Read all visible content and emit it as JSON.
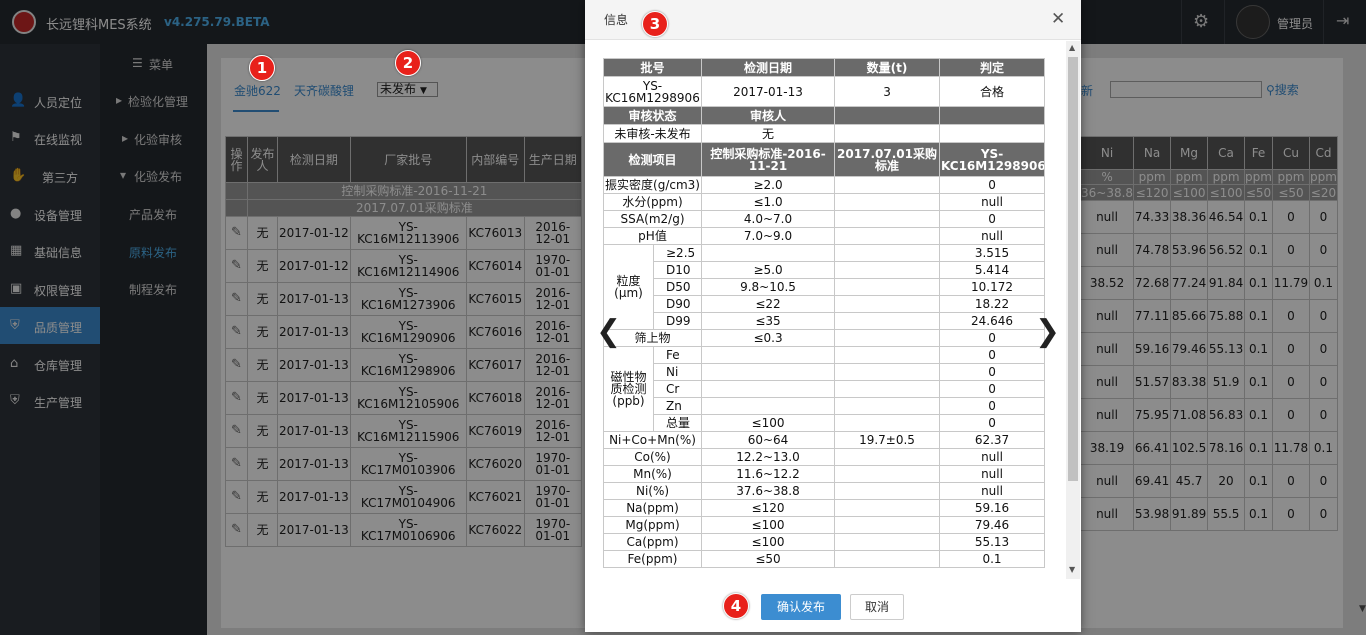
{
  "app": {
    "title": "长远锂科MES系统",
    "version": "v4.275.79.BETA",
    "user": "管理员"
  },
  "sidebar": {
    "items": [
      {
        "label": "人员定位",
        "icon": "user-location-icon"
      },
      {
        "label": "在线监视",
        "icon": "monitor-icon"
      },
      {
        "label": "第三方",
        "icon": "handshake-icon"
      },
      {
        "label": "设备管理",
        "icon": "device-icon"
      },
      {
        "label": "基础信息",
        "icon": "info-icon"
      },
      {
        "label": "权限管理",
        "icon": "lock-icon"
      },
      {
        "label": "品质管理",
        "icon": "shield-icon",
        "active": true
      },
      {
        "label": "仓库管理",
        "icon": "warehouse-icon"
      },
      {
        "label": "生产管理",
        "icon": "production-icon"
      }
    ]
  },
  "submenu": {
    "header": "菜单",
    "items": [
      "检验化管理",
      "化验审核",
      "化验发布",
      "产品发布",
      "原料发布",
      "制程发布"
    ]
  },
  "toolbar": {
    "tab1": "金驰622",
    "tab2": "天齐碳酸锂",
    "status": "未发布",
    "new_label": "新",
    "search_label": "搜索"
  },
  "grid": {
    "headers": [
      "操作",
      "发布人",
      "检测日期",
      "厂家批号",
      "内部编号",
      "生产日期"
    ],
    "band1": "控制采购标准-2016-11-21",
    "band2": "2017.07.01采购标准",
    "rows": [
      {
        "pub": "无",
        "date": "2017-01-12",
        "batch": "YS-KC16M12113906",
        "code": "KC76013",
        "prod": "2016-12-01"
      },
      {
        "pub": "无",
        "date": "2017-01-12",
        "batch": "YS-KC16M12114906",
        "code": "KC76014",
        "prod": "1970-01-01"
      },
      {
        "pub": "无",
        "date": "2017-01-13",
        "batch": "YS-KC16M1273906",
        "code": "KC76015",
        "prod": "2016-12-01"
      },
      {
        "pub": "无",
        "date": "2017-01-13",
        "batch": "YS-KC16M1290906",
        "code": "KC76016",
        "prod": "2016-12-01"
      },
      {
        "pub": "无",
        "date": "2017-01-13",
        "batch": "YS-KC16M1298906",
        "code": "KC76017",
        "prod": "2016-12-01"
      },
      {
        "pub": "无",
        "date": "2017-01-13",
        "batch": "YS-KC16M12105906",
        "code": "KC76018",
        "prod": "2016-12-01"
      },
      {
        "pub": "无",
        "date": "2017-01-13",
        "batch": "YS-KC16M12115906",
        "code": "KC76019",
        "prod": "2016-12-01"
      },
      {
        "pub": "无",
        "date": "2017-01-13",
        "batch": "YS-KC17M0103906",
        "code": "KC76020",
        "prod": "1970-01-01"
      },
      {
        "pub": "无",
        "date": "2017-01-13",
        "batch": "YS-KC17M0104906",
        "code": "KC76021",
        "prod": "1970-01-01"
      },
      {
        "pub": "无",
        "date": "2017-01-13",
        "batch": "YS-KC17M0106906",
        "code": "KC76022",
        "prod": "1970-01-01"
      }
    ]
  },
  "grid_right": {
    "headers": [
      "Ni",
      "Na",
      "Mg",
      "Ca",
      "Fe",
      "Cu",
      "Cd"
    ],
    "units": [
      "%",
      "ppm",
      "ppm",
      "ppm",
      "ppm",
      "ppm",
      "ppm"
    ],
    "limits": [
      "36~38.8",
      "≤120",
      "≤100",
      "≤100",
      "≤50",
      "≤50",
      "≤20"
    ],
    "rows": [
      [
        "null",
        "74.33",
        "38.36",
        "46.54",
        "0.1",
        "0",
        "0"
      ],
      [
        "null",
        "74.78",
        "53.96",
        "56.52",
        "0.1",
        "0",
        "0"
      ],
      [
        "38.52",
        "72.68",
        "77.24",
        "91.84",
        "0.1",
        "11.79",
        "0.1"
      ],
      [
        "null",
        "77.11",
        "85.66",
        "75.88",
        "0.1",
        "0",
        "0"
      ],
      [
        "null",
        "59.16",
        "79.46",
        "55.13",
        "0.1",
        "0",
        "0"
      ],
      [
        "null",
        "51.57",
        "83.38",
        "51.9",
        "0.1",
        "0",
        "0"
      ],
      [
        "null",
        "75.95",
        "71.08",
        "56.83",
        "0.1",
        "0",
        "0"
      ],
      [
        "38.19",
        "66.41",
        "102.5",
        "78.16",
        "0.1",
        "11.78",
        "0.1"
      ],
      [
        "null",
        "69.41",
        "45.7",
        "20",
        "0.1",
        "0",
        "0"
      ],
      [
        "null",
        "53.98",
        "91.89",
        "55.5",
        "0.1",
        "0",
        "0"
      ]
    ]
  },
  "dialog": {
    "title": "信息",
    "h_batch": "批号",
    "h_date": "检测日期",
    "h_qty": "数量(t)",
    "h_judge": "判定",
    "batch": "YS-KC16M1298906",
    "date": "2017-01-13",
    "qty": "3",
    "judge": "合格",
    "h_review": "审核状态",
    "h_reviewer": "审核人",
    "review": "未审核-未发布",
    "reviewer": "无",
    "h_item": "检测项目",
    "h_std1": "控制采购标准-2016-11-21",
    "h_std2": "2017.07.01采购标准",
    "h_result": "YS-KC16M1298906",
    "g_particle": "粒度(μm)",
    "g_magnetic": "磁性物质检测(ppb)",
    "rows": [
      {
        "item": "振实密度(g/cm3)",
        "s1": "≥2.0",
        "s2": "",
        "v": "0"
      },
      {
        "item": "水分(ppm)",
        "s1": "≤1.0",
        "s2": "",
        "v": "null"
      },
      {
        "item": "SSA(m2/g)",
        "s1": "4.0~7.0",
        "s2": "",
        "v": "0"
      },
      {
        "item": "pH值",
        "s1": "7.0~9.0",
        "s2": "",
        "v": "null"
      },
      {
        "sub": "≥2.5",
        "s1": "",
        "s2": "",
        "v": "3.515"
      },
      {
        "sub": "D10",
        "s1": "≥5.0",
        "s2": "",
        "v": "5.414"
      },
      {
        "sub": "D50",
        "s1": "9.8~10.5",
        "s2": "",
        "v": "10.172"
      },
      {
        "sub": "D90",
        "s1": "≤22",
        "s2": "",
        "v": "18.22"
      },
      {
        "sub": "D99",
        "s1": "≤35",
        "s2": "",
        "v": "24.646"
      },
      {
        "item": "筛上物",
        "s1": "≤0.3",
        "s2": "",
        "v": "0"
      },
      {
        "sub": "Fe",
        "s1": "",
        "s2": "",
        "v": "0"
      },
      {
        "sub": "Ni",
        "s1": "",
        "s2": "",
        "v": "0"
      },
      {
        "sub": "Cr",
        "s1": "",
        "s2": "",
        "v": "0"
      },
      {
        "sub": "Zn",
        "s1": "",
        "s2": "",
        "v": "0"
      },
      {
        "sub": "总量",
        "s1": "≤100",
        "s2": "",
        "v": "0"
      },
      {
        "item": "Ni+Co+Mn(%)",
        "s1": "60~64",
        "s2": "19.7±0.5",
        "v": "62.37"
      },
      {
        "item": "Co(%)",
        "s1": "12.2~13.0",
        "s2": "",
        "v": "null"
      },
      {
        "item": "Mn(%)",
        "s1": "11.6~12.2",
        "s2": "",
        "v": "null"
      },
      {
        "item": "Ni(%)",
        "s1": "37.6~38.8",
        "s2": "",
        "v": "null"
      },
      {
        "item": "Na(ppm)",
        "s1": "≤120",
        "s2": "",
        "v": "59.16"
      },
      {
        "item": "Mg(ppm)",
        "s1": "≤100",
        "s2": "",
        "v": "79.46"
      },
      {
        "item": "Ca(ppm)",
        "s1": "≤100",
        "s2": "",
        "v": "55.13"
      },
      {
        "item": "Fe(ppm)",
        "s1": "≤50",
        "s2": "",
        "v": "0.1"
      }
    ],
    "confirm": "确认发布",
    "cancel": "取消"
  },
  "badges": [
    "1",
    "2",
    "3",
    "4"
  ]
}
